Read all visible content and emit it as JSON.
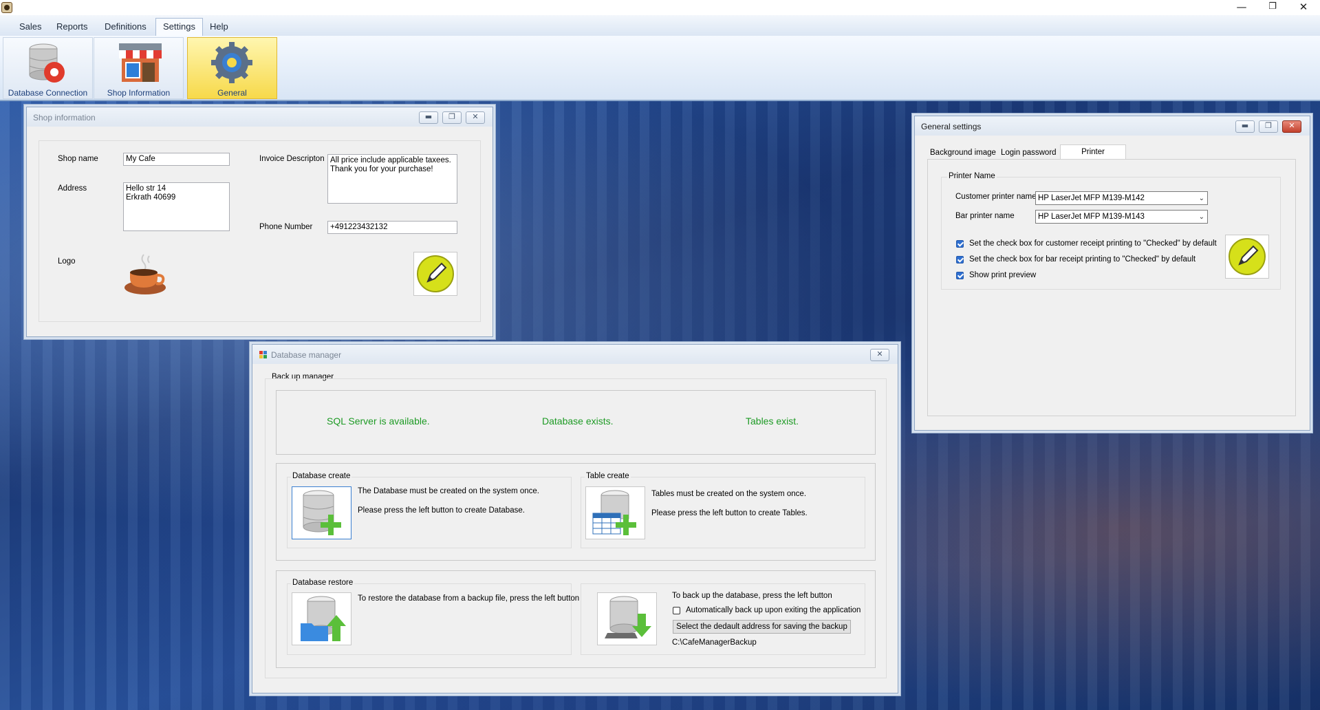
{
  "window_controls": {
    "minimize": "—",
    "restore": "❐",
    "close": "✕"
  },
  "menu": [
    "Sales",
    "Reports",
    "Definitions",
    "Settings",
    "Help"
  ],
  "ribbon": {
    "database_connection": "Database Connection",
    "shop_information": "Shop Information",
    "general": "General"
  },
  "shop_window": {
    "title": "Shop information",
    "shop_name_label": "Shop name",
    "shop_name_value": "My Cafe",
    "address_label": "Address",
    "address_value": "Hello str 14\nErkrath 40699",
    "invoice_label": "Invoice Descripton",
    "invoice_value": "All price include applicable taxees.\nThank you for your purchase!",
    "phone_label": "Phone Number",
    "phone_value": "+491223432132",
    "logo_label": "Logo"
  },
  "db_window": {
    "title": "Database manager",
    "backup_group": "Back up manager",
    "status": [
      "SQL Server is available.",
      "Database exists.",
      "Tables exist."
    ],
    "db_create_title": "Database create",
    "db_create_line1": "The Database must be created on the system once.",
    "db_create_line2": "Please press the left button to create Database.",
    "table_create_title": "Table create",
    "table_create_line1": "Tables must be created on the system once.",
    "table_create_line2": "Please press the left button to create Tables.",
    "restore_title": "Database restore",
    "restore_text": "To restore the database from a backup file, press the left button",
    "backup_text": "To back up the database, press the left button",
    "auto_backup_label": "Automatically back up upon exiting the application",
    "select_address_button": "Select the dedault address for saving the backup",
    "backup_path": "C:\\CafeManagerBackup"
  },
  "settings_window": {
    "title": "General settings",
    "tabs": [
      "Background image",
      "Login password",
      "Printer"
    ],
    "printer_group": "Printer Name",
    "customer_printer_label": "Customer printer name",
    "customer_printer_value": "HP LaserJet MFP M139-M142",
    "bar_printer_label": "Bar printer name",
    "bar_printer_value": "HP LaserJet MFP M139-M143",
    "check1": "Set the check box for customer receipt printing to \"Checked\"  by default",
    "check2": "Set the check box for bar receipt printing to \"Checked\"  by default",
    "check3": "Show print preview"
  }
}
